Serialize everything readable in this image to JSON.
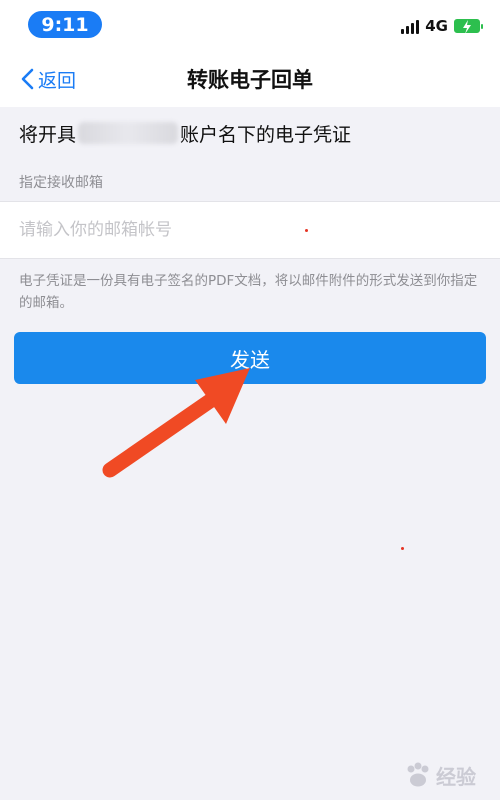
{
  "status_bar": {
    "time": "9:11",
    "network": "4G",
    "battery_icon": "battery-charging-icon",
    "signal_icon": "signal-icon"
  },
  "nav": {
    "back_label": "返回",
    "title": "转账电子回单"
  },
  "account_line": {
    "prefix": "将开具",
    "suffix": "账户名下的电子凭证"
  },
  "email_section": {
    "label": "指定接收邮箱",
    "placeholder": "请输入你的邮箱帐号",
    "value": ""
  },
  "hint": "电子凭证是一份具有电子签名的PDF文档，将以邮件附件的形式发送到你指定的邮箱。",
  "send_button": {
    "label": "发送"
  },
  "watermark": {
    "text": "经验"
  },
  "colors": {
    "accent": "#1a7cf5",
    "button": "#1a89ec",
    "background": "#f2f2f7",
    "arrow": "#f04a24",
    "battery": "#2dbf4e"
  }
}
